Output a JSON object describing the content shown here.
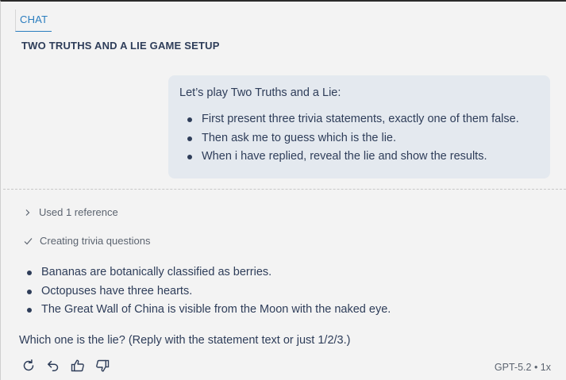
{
  "tab": {
    "label": "CHAT"
  },
  "chat": {
    "title": "TWO TRUTHS AND A LIE GAME SETUP"
  },
  "user_message": {
    "intro": "Let’s play Two Truths and a Lie:",
    "bullets": [
      "First present three trivia statements, exactly one of them false.",
      "Then ask me to guess which is the lie.",
      "When i have replied, reveal the lie and show the results."
    ]
  },
  "assistant_message": {
    "references_label": "Used 1 reference",
    "progress_label": "Creating trivia questions",
    "statements": [
      "Bananas are botanically classified as berries.",
      "Octopuses have three hearts.",
      "The Great Wall of China is visible from the Moon with the naked eye."
    ],
    "question": "Which one is the lie? (Reply with the statement text or just 1/2/3.)",
    "actions": [
      "retry-icon",
      "undo-icon",
      "thumbs-up-icon",
      "thumbs-down-icon"
    ],
    "meta": "GPT-5.2 • 1x"
  },
  "colors": {
    "accent": "#2a7dbf",
    "text": "#2e3d59",
    "muted": "#5c6470",
    "bubble": "#e4e9ef",
    "background": "#f3f3f3"
  }
}
